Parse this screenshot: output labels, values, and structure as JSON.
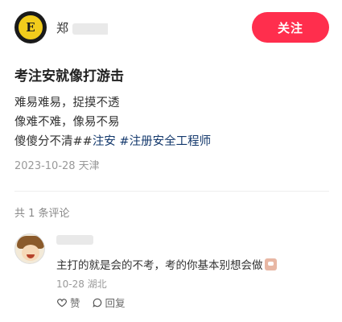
{
  "header": {
    "logo_letters": "E",
    "username": "郑",
    "follow_label": "关注",
    "follow_color": "#ff2e4d"
  },
  "post": {
    "title": "考注安就像打游击",
    "lines": [
      "难易难易，捉摸不透",
      "像难不难，像易不易"
    ],
    "line3_text": "傻傻分不清##",
    "tags": [
      "注安",
      "#注册安全工程师"
    ],
    "meta": "2023-10-28 天津"
  },
  "comments": {
    "count_label": "共 1 条评论",
    "items": [
      {
        "text": "主打的就是会的不考，考的你基本别想会做",
        "meta": "10-28 湖北",
        "like_label": "赞",
        "reply_label": "回复"
      }
    ]
  },
  "icons": {
    "avatar": "team-badge-icon",
    "like": "heart-outline-icon",
    "reply": "speech-bubble-icon"
  }
}
